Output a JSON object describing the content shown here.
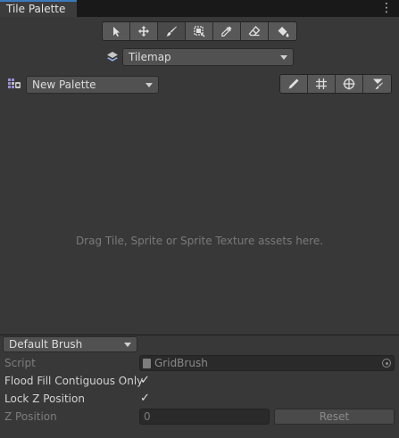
{
  "window": {
    "tab_title": "Tile Palette"
  },
  "toolbar": {
    "tools": [
      {
        "name": "select-icon"
      },
      {
        "name": "move-icon"
      },
      {
        "name": "paint-brush-icon",
        "active": true
      },
      {
        "name": "box-fill-icon"
      },
      {
        "name": "picker-icon"
      },
      {
        "name": "eraser-icon"
      },
      {
        "name": "flood-fill-icon"
      }
    ]
  },
  "tilemap": {
    "selected": "Tilemap"
  },
  "palette": {
    "selected": "New Palette"
  },
  "edit_tools": [
    "edit-pencil-icon",
    "grid-icon",
    "gizmo-icon",
    "brush-settings-icon"
  ],
  "canvas": {
    "hint": "Drag Tile, Sprite or Sprite Texture assets here."
  },
  "brush": {
    "selected": "Default Brush",
    "script_label": "Script",
    "script_value": "GridBrush",
    "flood_fill_label": "Flood Fill Contiguous Only",
    "flood_fill_checked": "✓",
    "lock_z_label": "Lock Z Position",
    "lock_z_checked": "✓",
    "z_position_label": "Z Position",
    "z_position_value": "0",
    "reset_label": "Reset"
  },
  "colors": {
    "accent": "#3a79bb",
    "background": "#383838"
  }
}
